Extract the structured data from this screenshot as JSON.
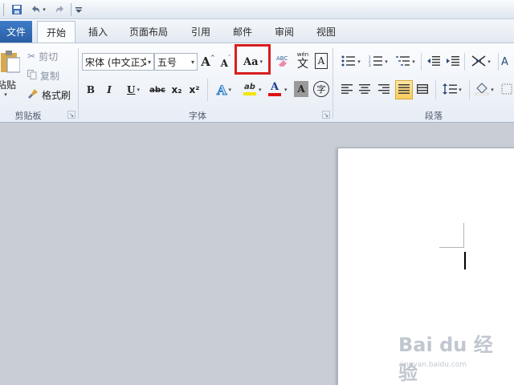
{
  "quick_access": {
    "save_icon": "save-icon",
    "undo_icon": "undo-icon",
    "redo_icon": "redo-icon",
    "customize_icon": "customize-qat-icon"
  },
  "tabs": {
    "file": "文件",
    "items": [
      "开始",
      "插入",
      "页面布局",
      "引用",
      "邮件",
      "审阅",
      "视图"
    ],
    "active": "开始"
  },
  "clipboard": {
    "paste_label": "粘贴",
    "cut_label": "剪切",
    "copy_label": "复制",
    "format_painter_label": "格式刷",
    "group_label": "剪贴板"
  },
  "font": {
    "font_name": "宋体 (中文正文",
    "font_size": "五号",
    "grow_font": "A",
    "shrink_font": "A",
    "change_case": "Aa",
    "bold": "B",
    "italic": "I",
    "underline": "U",
    "strikethrough": "abc",
    "subscript": "x₂",
    "superscript": "x²",
    "text_effects": "A",
    "highlight": "ab",
    "font_color": "A",
    "char_shading": "A",
    "enclose_char": "字",
    "phonetic_guide_top": "wén",
    "phonetic_guide": "文",
    "char_border": "A",
    "group_label": "字体"
  },
  "paragraph": {
    "group_label": "段落"
  },
  "colors": {
    "highlight_box": "#d81e1e",
    "highlight_yellow": "#f5e400",
    "font_color_red": "#e01010",
    "file_tab": "#2f66b0"
  },
  "watermark": {
    "main": "Bai du 经验",
    "sub": "jingyan.baidu.com"
  }
}
